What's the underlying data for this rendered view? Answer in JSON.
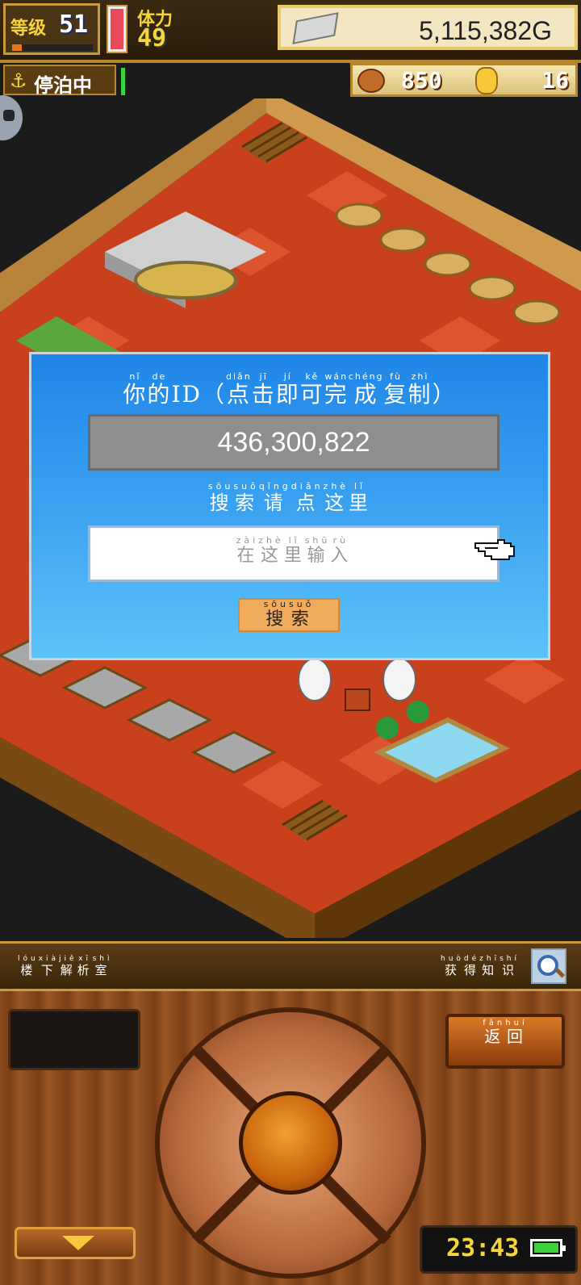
{
  "hud": {
    "level_label": "等级",
    "level_value": "51",
    "stamina_label": "体力",
    "stamina_value": "49",
    "gold": "5,115,382G",
    "status_label": "停泊中",
    "food": "850",
    "medals": "16"
  },
  "dialog": {
    "id_title": [
      {
        "char": "你",
        "py": "nǐ"
      },
      {
        "char": "的",
        "py": "de"
      },
      {
        "char": "ID",
        "py": ""
      },
      {
        "char": "（",
        "py": ""
      },
      {
        "char": "点",
        "py": "diǎn"
      },
      {
        "char": "击",
        "py": "jī"
      },
      {
        "char": "即",
        "py": "jí"
      },
      {
        "char": "可",
        "py": "kě"
      },
      {
        "char": "完",
        "py": "wán"
      },
      {
        "char": "成",
        "py": "chéng"
      },
      {
        "char": "复",
        "py": "fù"
      },
      {
        "char": "制",
        "py": "zhì"
      },
      {
        "char": "）",
        "py": ""
      }
    ],
    "id_value": "436,300,822",
    "search_title": [
      {
        "char": "搜",
        "py": "sōu"
      },
      {
        "char": "索",
        "py": "suǒ"
      },
      {
        "char": "请",
        "py": "qǐng"
      },
      {
        "char": "点",
        "py": "diǎn"
      },
      {
        "char": "这",
        "py": "zhè"
      },
      {
        "char": "里",
        "py": "lǐ"
      }
    ],
    "search_placeholder": [
      {
        "char": "在",
        "py": "zài"
      },
      {
        "char": "这",
        "py": "zhè"
      },
      {
        "char": "里",
        "py": "lǐ"
      },
      {
        "char": "输",
        "py": "shū"
      },
      {
        "char": "入",
        "py": "rù"
      }
    ],
    "search_button": [
      {
        "char": "搜",
        "py": "sōu"
      },
      {
        "char": "索",
        "py": "suǒ"
      }
    ]
  },
  "info_bar": {
    "left": [
      {
        "char": "楼",
        "py": "lóu"
      },
      {
        "char": "下",
        "py": "xià"
      },
      {
        "char": "解",
        "py": "jiě"
      },
      {
        "char": "析",
        "py": "xī"
      },
      {
        "char": "室",
        "py": "shì"
      }
    ],
    "right": [
      {
        "char": "获",
        "py": "huò"
      },
      {
        "char": "得",
        "py": "dé"
      },
      {
        "char": "知",
        "py": "zhī"
      },
      {
        "char": "识",
        "py": "shí"
      }
    ]
  },
  "controls": {
    "return_button": [
      {
        "char": "返",
        "py": "fǎn"
      },
      {
        "char": "回",
        "py": "huí"
      }
    ],
    "clock": "23:43"
  },
  "colors": {
    "dialog_top": "#1f86e8",
    "dialog_bottom": "#5dc3fa",
    "search_button": "#f0ab5c",
    "gold_text": "#f6d63a"
  },
  "icons": [
    "anchor-icon",
    "silver-bar-icon",
    "food-icon",
    "medal-icon",
    "pointer-hand-icon",
    "magnifier-icon",
    "battery-icon",
    "down-arrow-icon"
  ]
}
